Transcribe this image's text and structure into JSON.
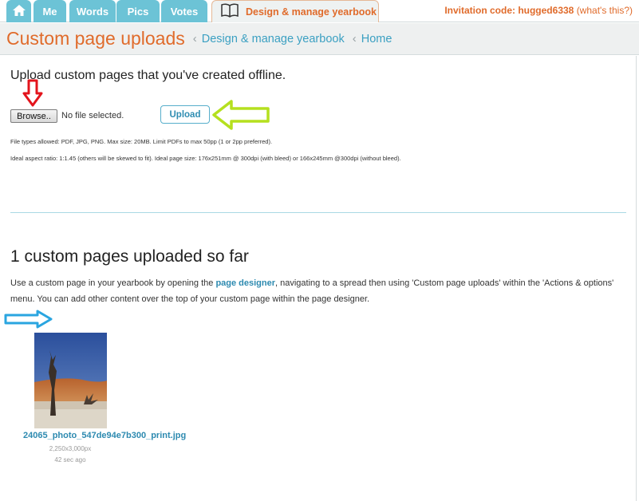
{
  "nav": {
    "tabs": [
      {
        "label": ""
      },
      {
        "label": "Me"
      },
      {
        "label": "Words"
      },
      {
        "label": "Pics"
      },
      {
        "label": "Votes"
      },
      {
        "label": "Design & manage yearbook"
      }
    ],
    "home_icon": "home-icon",
    "design_icon": "open-book-icon",
    "invitation_label": "Invitation code: hugged6338",
    "whats_this": "(what's this?)"
  },
  "header": {
    "title": "Custom page uploads",
    "breadcrumbs": [
      "Design & manage yearbook",
      "Home"
    ],
    "separator": "‹"
  },
  "upload": {
    "intro": "Upload custom pages that you've created offline.",
    "browse_label": "Browse..",
    "no_file_text": "No file selected.",
    "upload_label": "Upload",
    "note_types": "File types allowed: PDF, JPG, PNG. Max size: 20MB. Limit PDFs to max 50pp (1 or 2pp preferred).",
    "note_ratio": "Ideal aspect ratio: 1:1.45 (others will be skewed to fit). Ideal page size: 176x251mm @ 300dpi (with bleed) or 166x245mm @300dpi (without bleed)."
  },
  "uploads_list": {
    "heading": "1 custom pages uploaded so far",
    "desc_before": "Use a custom page in your yearbook by opening the ",
    "desc_link": "page designer",
    "desc_after": ", navigating to a spread then using 'Custom page uploads' within the 'Actions & options' menu. You can add other content over the top of your custom page within the page designer.",
    "files": [
      {
        "name": "24065_photo_547de94e7b300_print.jpg",
        "dims": "2,250x3,000px",
        "age": "42 sec ago"
      }
    ]
  },
  "annotations": {
    "red": "#e3141c",
    "green": "#b5e01f",
    "blue": "#2aa5e0"
  },
  "colors": {
    "accent_orange": "#e06b2b",
    "tab_blue": "#6cc3d6",
    "link_blue": "#2d8ab0"
  }
}
